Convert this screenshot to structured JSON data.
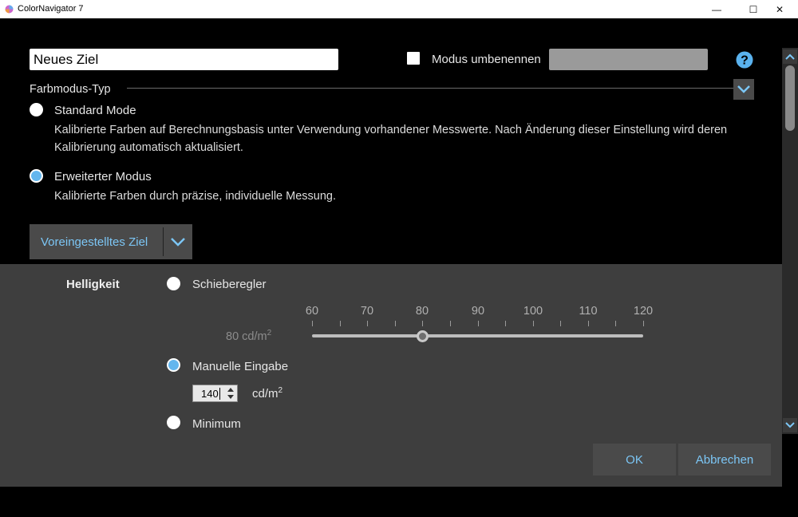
{
  "window": {
    "title": "ColorNavigator 7",
    "minimize_glyph": "—",
    "maximize_glyph": "☐",
    "close_glyph": "✕"
  },
  "header": {
    "name_value": "Neues Ziel",
    "rename_checked": false,
    "rename_label": "Modus umbenennen",
    "rename_value": ""
  },
  "color_mode": {
    "section_title": "Farbmodus-Typ",
    "options": [
      {
        "label": "Standard Mode",
        "selected": false,
        "description": "Kalibrierte Farben auf Berechnungsbasis unter Verwendung vorhandener Messwerte. Nach Änderung dieser Einstellung wird deren Kalibrierung automatisch aktualisiert."
      },
      {
        "label": "Erweiterter Modus",
        "selected": true,
        "description": "Kalibrierte Farben durch präzise, individuelle Messung."
      }
    ],
    "target_dropdown_label": "Voreingestelltes Ziel"
  },
  "brightness": {
    "label": "Helligkeit",
    "slider_option": {
      "label": "Schieberegler",
      "selected": false
    },
    "slider": {
      "scale": [
        "60",
        "70",
        "80",
        "90",
        "100",
        "110",
        "120"
      ],
      "min": 60,
      "max": 120,
      "value": 80,
      "value_text": "80 cd/m",
      "value_sup": "2"
    },
    "manual_option": {
      "label": "Manuelle Eingabe",
      "selected": true
    },
    "manual_value": "140",
    "unit": "cd/m",
    "unit_sup": "2",
    "minimum_option": {
      "label": "Minimum",
      "selected": false
    }
  },
  "buttons": {
    "ok": "OK",
    "cancel": "Abbrechen"
  },
  "colors": {
    "accent": "#63b6ee",
    "link_text": "#7cc6f5",
    "lower_panel": "#3e3e3e",
    "button_bg": "#4a4a4a"
  },
  "icons": {
    "help": "question-circle-icon",
    "collapse": "chevron-down-icon",
    "dropdown": "chevron-down-icon",
    "spin": "spin-arrows-icon",
    "scroll_up": "triangle-up-icon",
    "scroll_down": "triangle-down-icon"
  }
}
